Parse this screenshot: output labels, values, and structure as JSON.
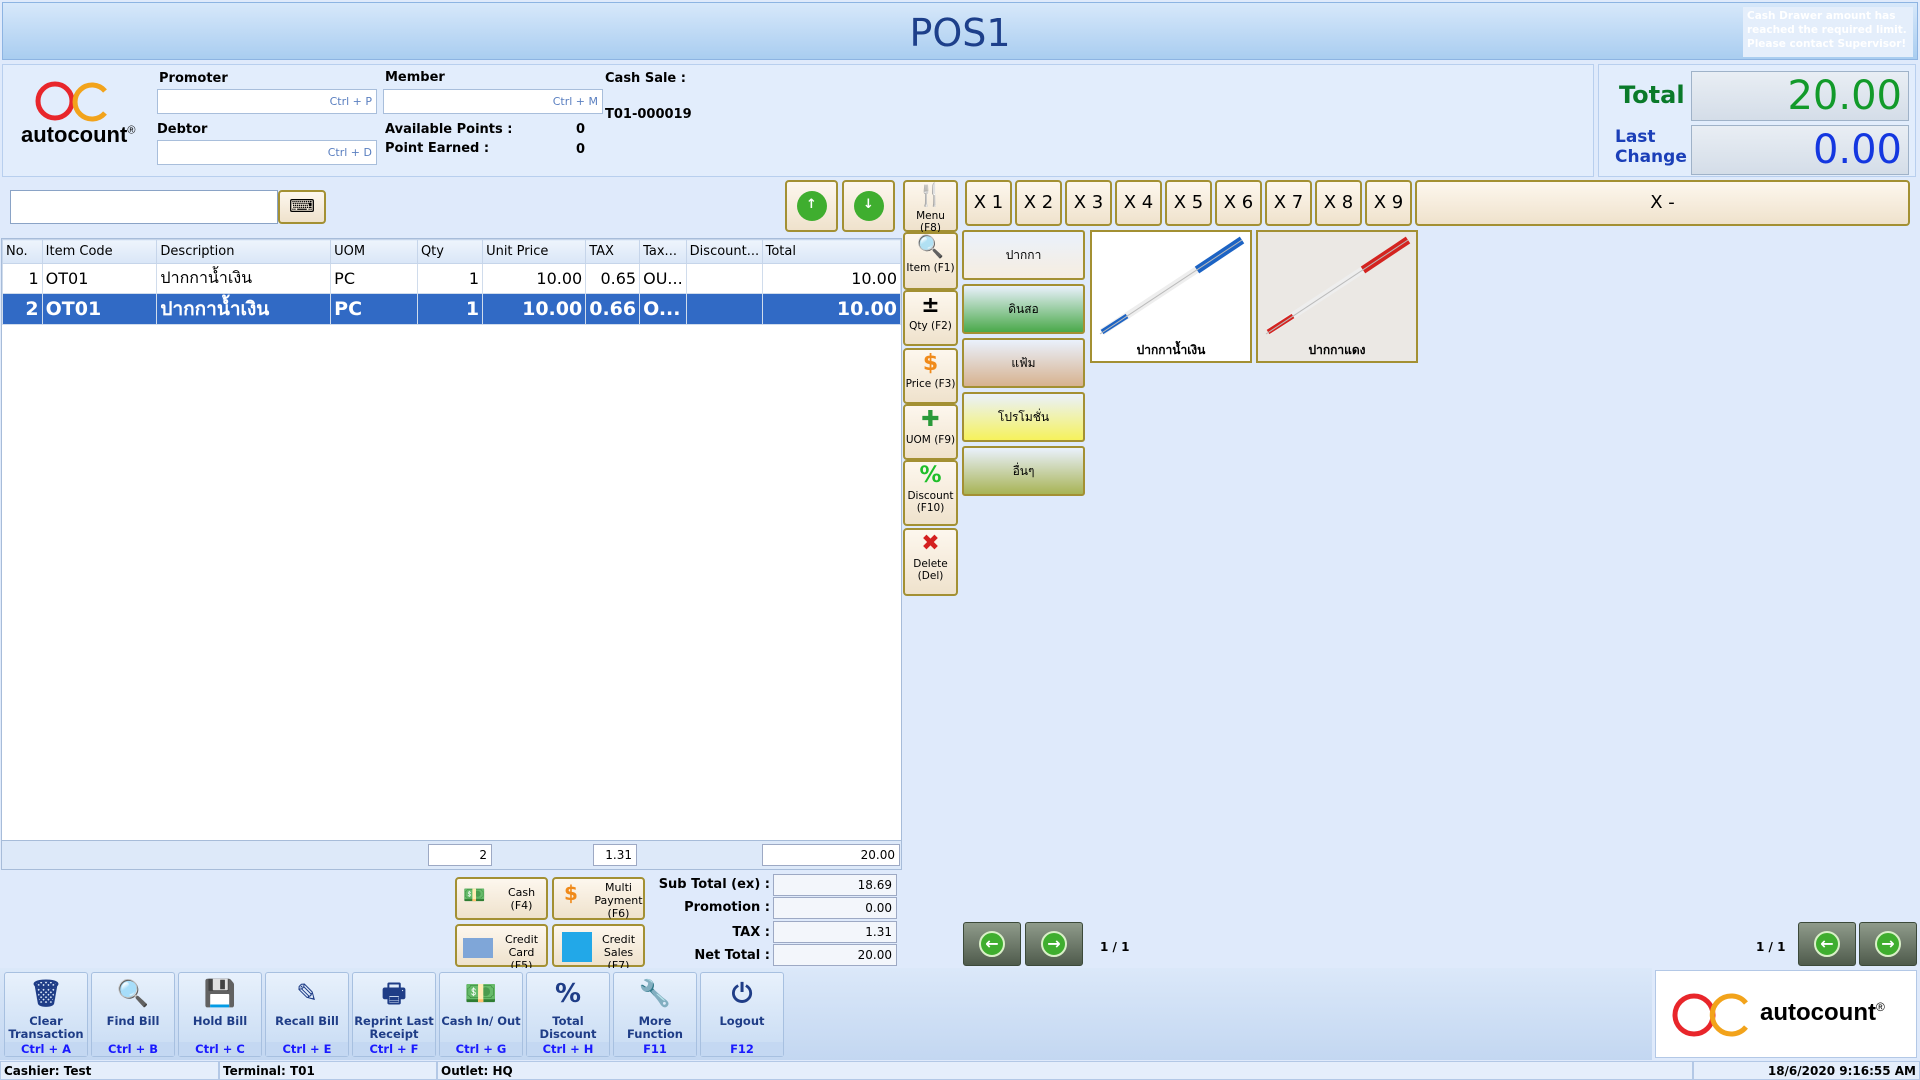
{
  "window": {
    "title": "POS1",
    "alert": "Cash Drawer amount has reached the required limit. Please contact Supervisor!"
  },
  "brand": {
    "logo_text": "autocount",
    "registered": "®"
  },
  "header": {
    "promoter_label": "Promoter",
    "promoter_hint": "Ctrl + P",
    "member_label": "Member",
    "member_hint": "Ctrl + M",
    "debtor_label": "Debtor",
    "debtor_hint": "Ctrl + D",
    "cash_sale_label": "Cash Sale :",
    "doc_no": "T01-000019",
    "available_points_label": "Available Points :",
    "available_points": "0",
    "point_earned_label": "Point Earned :",
    "point_earned": "0"
  },
  "summary": {
    "total_label": "Total",
    "total": "20.00",
    "last_change_label": "Last Change",
    "last_change": "0.00"
  },
  "search": {
    "value": "",
    "keyboard_icon": "keyboard-icon"
  },
  "table": {
    "columns": [
      "No.",
      "Item Code",
      "Description",
      "UOM",
      "Qty",
      "Unit Price",
      "TAX",
      "Tax...",
      "Discount...",
      "Total"
    ],
    "rows": [
      [
        "1",
        "OT01",
        "ปากกาน้ำเงิน",
        "PC",
        "1",
        "10.00",
        "0.65",
        "OU...",
        "",
        "10.00"
      ],
      [
        "2",
        "OT01",
        "ปากกาน้ำเงิน",
        "PC",
        "1",
        "10.00",
        "0.66",
        "O...",
        "",
        "10.00"
      ]
    ],
    "footer": {
      "qty": "2",
      "tax": "1.31",
      "total": "20.00"
    },
    "selected_row": 2
  },
  "multipliers": [
    "X 1",
    "X 2",
    "X 3",
    "X 4",
    "X 5",
    "X 6",
    "X 7",
    "X 8",
    "X 9",
    "X -"
  ],
  "side_buttons": [
    {
      "label": "Menu (F8)"
    },
    {
      "label": "Item (F1)"
    },
    {
      "label": "Qty (F2)"
    },
    {
      "label": "Price (F3)"
    },
    {
      "label": "UOM (F9)"
    },
    {
      "label": "Discount (F10)"
    },
    {
      "label": "Delete (Del)"
    }
  ],
  "categories": [
    {
      "label": "ปากกา",
      "color": "#f6ede0"
    },
    {
      "label": "ดินสอ",
      "color": "#4aa94a"
    },
    {
      "label": "แฟ้ม",
      "color": "#d7b28f"
    },
    {
      "label": "โปรโมชั่น",
      "color": "#f6f25c"
    },
    {
      "label": "อื่นๆ",
      "color": "#a8b455"
    }
  ],
  "products": [
    {
      "label": "ปากกาน้ำเงิน",
      "color": "#1c63c4"
    },
    {
      "label": "ปากกาแดง",
      "color": "#d4231f"
    }
  ],
  "payment": {
    "cash": "Cash (F4)",
    "multi": "Multi Payment (F6)",
    "credit_card": "Credit Card (F5)",
    "credit_sales": "Credit Sales (F7)"
  },
  "totals": {
    "subtotal_label": "Sub Total (ex) :",
    "subtotal": "18.69",
    "promotion_label": "Promotion :",
    "promotion": "0.00",
    "tax_label": "TAX :",
    "tax": "1.31",
    "net_label": "Net Total :",
    "net": "20.00"
  },
  "pagination": {
    "left": "1 / 1",
    "right": "1 / 1"
  },
  "toolbar": [
    {
      "label": "Clear Transaction",
      "key": "Ctrl + A",
      "icon": "🗑"
    },
    {
      "label": "Find Bill",
      "key": "Ctrl + B",
      "icon": "🔍"
    },
    {
      "label": "Hold Bill",
      "key": "Ctrl + C",
      "icon": "💾"
    },
    {
      "label": "Recall Bill",
      "key": "Ctrl + E",
      "icon": "✎"
    },
    {
      "label": "Reprint Last Receipt",
      "key": "Ctrl + F",
      "icon": "🖶"
    },
    {
      "label": "Cash In/ Out",
      "key": "Ctrl + G",
      "icon": "💵"
    },
    {
      "label": "Total Discount",
      "key": "Ctrl + H",
      "icon": "%"
    },
    {
      "label": "More Function",
      "key": "F11",
      "icon": "🔧"
    },
    {
      "label": "Logout",
      "key": "F12",
      "icon": "⏻"
    }
  ],
  "status": {
    "cashier": "Cashier: Test",
    "terminal": "Terminal: T01",
    "outlet": "Outlet: HQ",
    "datetime": "18/6/2020 9:16:55 AM"
  }
}
